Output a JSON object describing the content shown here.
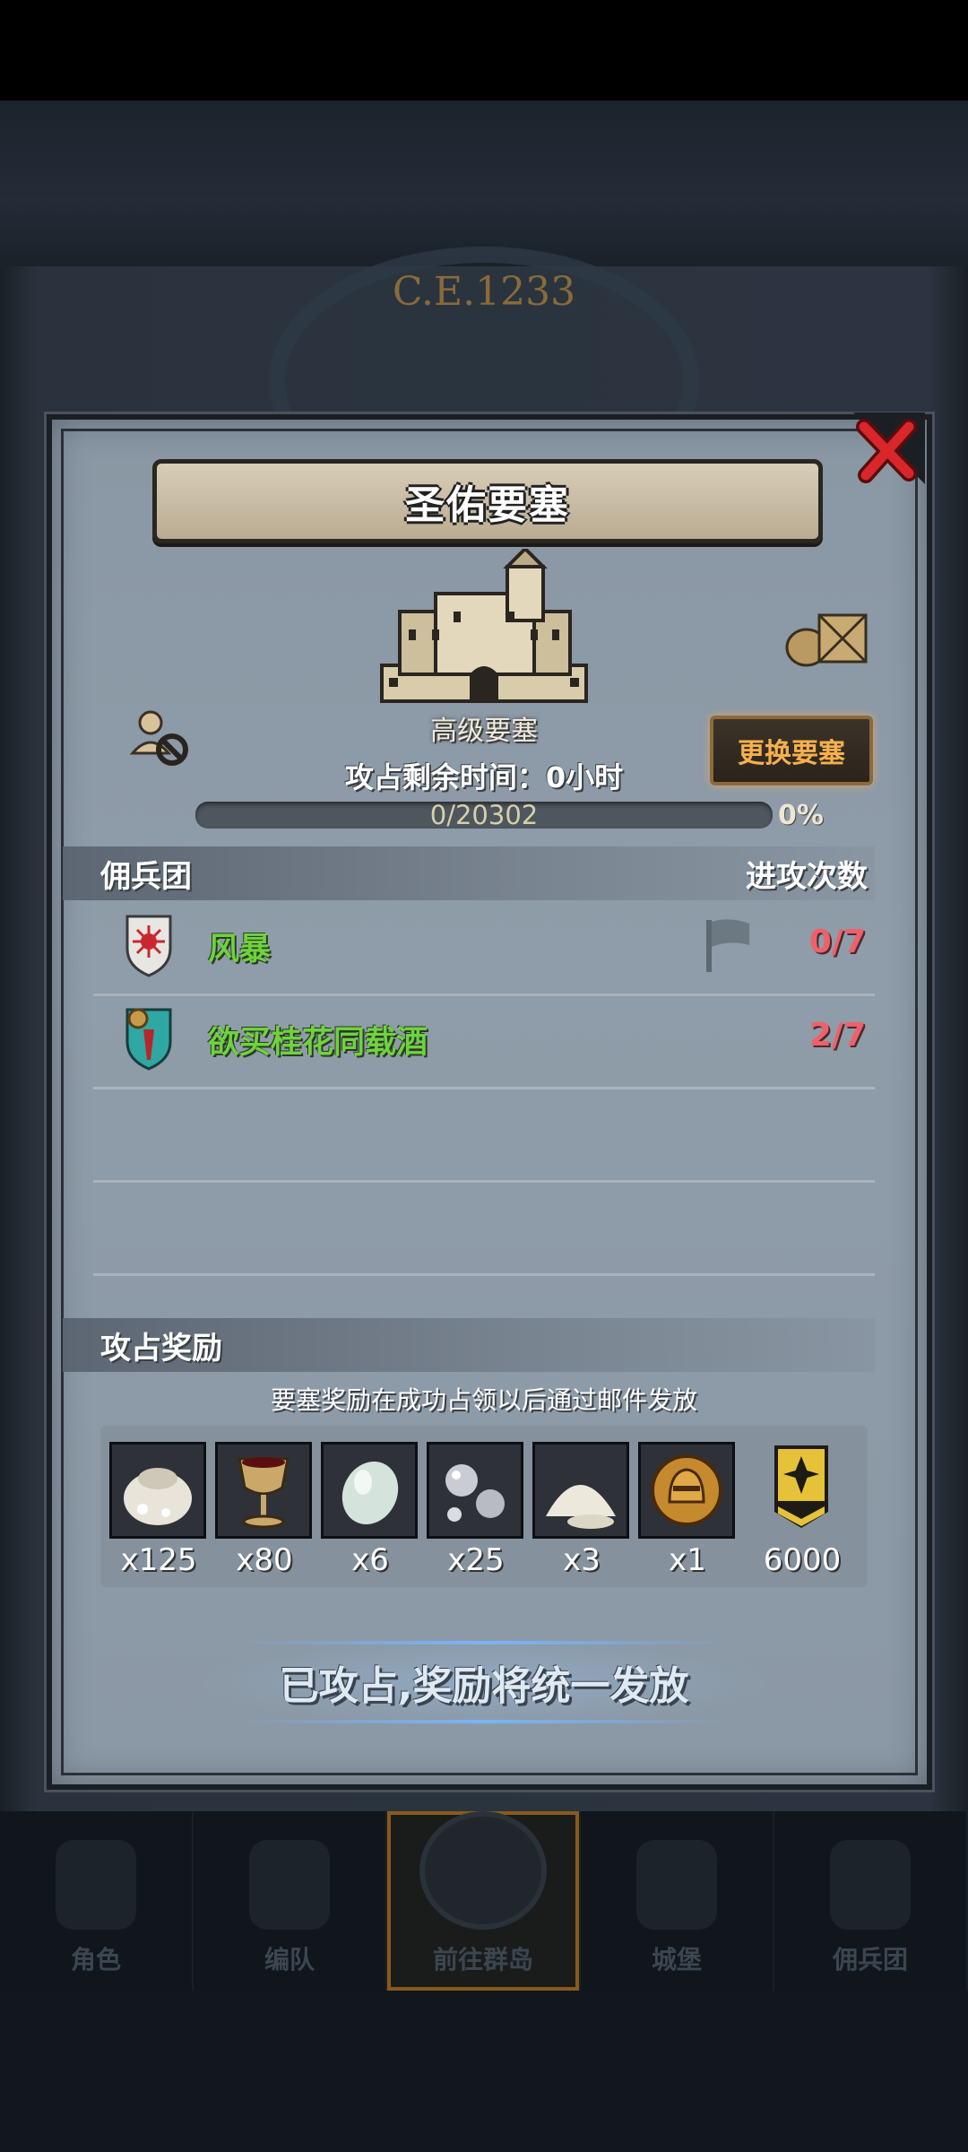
{
  "background": {
    "era_label": "C.E.1233",
    "nav": [
      "角色",
      "编队",
      "前往群岛",
      "城堡",
      "佣兵团"
    ],
    "active_nav": "前往群岛"
  },
  "dialog": {
    "title": "圣佑要塞",
    "fortress_level": "高级要塞",
    "change_button": "更换要塞",
    "time_label": "攻占剩余时间：0小时",
    "progress_text": "0/20302",
    "progress_percent_label": "0%",
    "progress_fraction": 0,
    "mercenary_header": "佣兵团",
    "attack_count_header": "进攻次数",
    "rows": [
      {
        "name": "风暴",
        "count": "0/7",
        "emblem": "red-sun-shield-icon",
        "flag": true
      },
      {
        "name": "欲买桂花同载酒",
        "count": "2/7",
        "emblem": "teal-medal-shield-icon",
        "flag": false
      }
    ],
    "reward_header": "攻占奖励",
    "reward_note": "要塞奖励在成功占领以后通过邮件发放",
    "rewards": [
      {
        "icon": "flour-sack-icon",
        "qty": "x125"
      },
      {
        "icon": "goblet-icon",
        "qty": "x80"
      },
      {
        "icon": "moonstone-icon",
        "qty": "x6"
      },
      {
        "icon": "silver-pearls-icon",
        "qty": "x25"
      },
      {
        "icon": "salt-pile-icon",
        "qty": "x3"
      },
      {
        "icon": "golden-helmet-coin-icon",
        "qty": "x1"
      },
      {
        "icon": "rank-insignia-icon",
        "qty": "6000"
      }
    ],
    "footer_text": "已攻占,奖励将统一发放"
  }
}
